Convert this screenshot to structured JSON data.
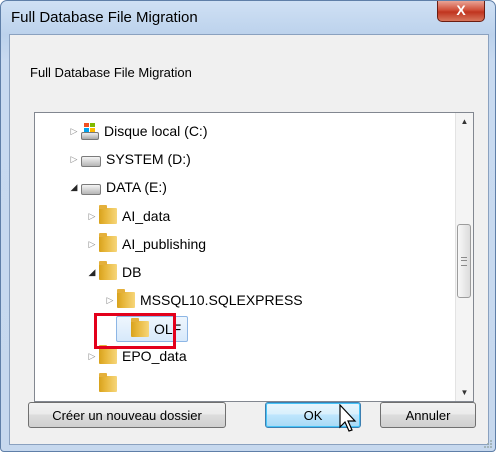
{
  "window": {
    "title": "Full Database File Migration",
    "close_label": "X"
  },
  "dialog": {
    "description": "Full Database File Migration"
  },
  "tree": {
    "items": [
      {
        "label": "Disque local (C:)",
        "icon": "windows-drive-icon",
        "expander": "collapsed"
      },
      {
        "label": "SYSTEM (D:)",
        "icon": "drive-icon",
        "expander": "collapsed"
      },
      {
        "label": "DATA (E:)",
        "icon": "drive-icon",
        "expander": "expanded"
      },
      {
        "label": "AI_data",
        "icon": "folder-icon",
        "expander": "collapsed"
      },
      {
        "label": "AI_publishing",
        "icon": "folder-icon",
        "expander": "collapsed"
      },
      {
        "label": "DB",
        "icon": "folder-icon",
        "expander": "expanded"
      },
      {
        "label": "MSSQL10.SQLEXPRESS",
        "icon": "folder-icon",
        "expander": "collapsed"
      },
      {
        "label": "OLF",
        "icon": "folder-icon",
        "expander": "none",
        "selected": true
      },
      {
        "label": "EPO_data",
        "icon": "folder-icon",
        "expander": "collapsed"
      }
    ]
  },
  "buttons": {
    "new_folder": "Créer un nouveau dossier",
    "ok": "OK",
    "cancel": "Annuler"
  },
  "colors": {
    "highlight_box": "#e3001b",
    "selection_fill": "#d7e9fb",
    "title_bar": "#bcd2ec"
  }
}
